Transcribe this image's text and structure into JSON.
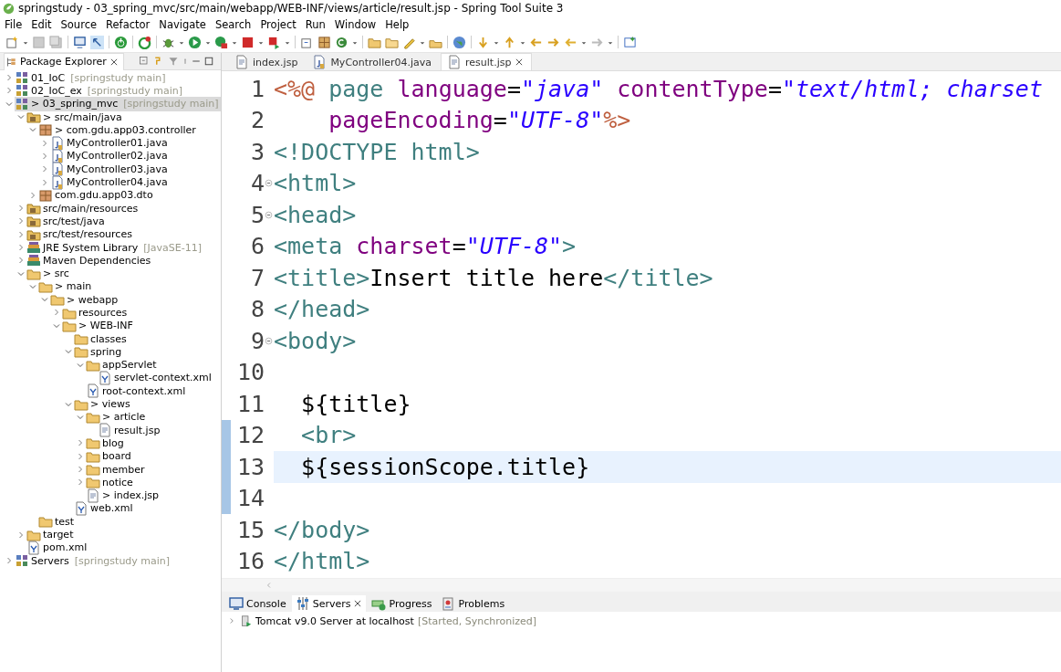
{
  "window": {
    "title": "springstudy - 03_spring_mvc/src/main/webapp/WEB-INF/views/article/result.jsp - Spring Tool Suite 3"
  },
  "menu": [
    "File",
    "Edit",
    "Source",
    "Refactor",
    "Navigate",
    "Search",
    "Project",
    "Run",
    "Window",
    "Help"
  ],
  "package_explorer": {
    "title": "Package Explorer",
    "items": [
      {
        "label": "01_IoC",
        "decoration": "[springstudy main]",
        "kind": "project",
        "expanded": false,
        "selected": false
      },
      {
        "label": "02_IoC_ex",
        "decoration": "[springstudy main]",
        "kind": "project",
        "expanded": false,
        "selected": false
      },
      {
        "label": "> 03_spring_mvc",
        "decoration": "[springstudy main]",
        "kind": "project",
        "expanded": true,
        "selected": true,
        "children": [
          {
            "label": "> src/main/java",
            "kind": "srcfolder",
            "expanded": true,
            "selected": false,
            "children": [
              {
                "label": "> com.gdu.app03.controller",
                "kind": "package",
                "expanded": true,
                "selected": false,
                "children": [
                  {
                    "label": "MyController01.java",
                    "kind": "java",
                    "expanded": false,
                    "selected": false
                  },
                  {
                    "label": "MyController02.java",
                    "kind": "java",
                    "expanded": false,
                    "selected": false
                  },
                  {
                    "label": "MyController03.java",
                    "kind": "java",
                    "expanded": false,
                    "selected": false
                  },
                  {
                    "label": "MyController04.java",
                    "kind": "java",
                    "expanded": false,
                    "selected": false
                  }
                ]
              },
              {
                "label": "com.gdu.app03.dto",
                "kind": "package",
                "expanded": false,
                "selected": false
              }
            ]
          },
          {
            "label": "src/main/resources",
            "kind": "srcfolder",
            "expanded": false,
            "selected": false
          },
          {
            "label": "src/test/java",
            "kind": "srcfolder",
            "expanded": false,
            "selected": false
          },
          {
            "label": "src/test/resources",
            "kind": "srcfolder",
            "expanded": false,
            "selected": false
          },
          {
            "label": "JRE System Library",
            "decoration": "[JavaSE-11]",
            "kind": "library",
            "expanded": false,
            "selected": false
          },
          {
            "label": "Maven Dependencies",
            "kind": "library",
            "expanded": false,
            "selected": false
          },
          {
            "label": "> src",
            "kind": "folder",
            "expanded": true,
            "selected": false,
            "children": [
              {
                "label": "> main",
                "kind": "folder",
                "expanded": true,
                "selected": false,
                "children": [
                  {
                    "label": "> webapp",
                    "kind": "folder",
                    "expanded": true,
                    "selected": false,
                    "children": [
                      {
                        "label": "resources",
                        "kind": "folder",
                        "expanded": false,
                        "selected": false
                      },
                      {
                        "label": "> WEB-INF",
                        "kind": "folder",
                        "expanded": true,
                        "selected": false,
                        "children": [
                          {
                            "label": "classes",
                            "kind": "folder",
                            "selected": false
                          },
                          {
                            "label": "spring",
                            "kind": "folder",
                            "expanded": true,
                            "selected": false,
                            "children": [
                              {
                                "label": "appServlet",
                                "kind": "folder",
                                "expanded": true,
                                "selected": false,
                                "children": [
                                  {
                                    "label": "servlet-context.xml",
                                    "kind": "xml",
                                    "selected": false
                                  }
                                ]
                              },
                              {
                                "label": "root-context.xml",
                                "kind": "xml",
                                "selected": false
                              }
                            ]
                          },
                          {
                            "label": "> views",
                            "kind": "folder",
                            "expanded": true,
                            "selected": false,
                            "children": [
                              {
                                "label": "> article",
                                "kind": "folder",
                                "expanded": true,
                                "selected": false,
                                "children": [
                                  {
                                    "label": "result.jsp",
                                    "kind": "jsp",
                                    "selected": false
                                  }
                                ]
                              },
                              {
                                "label": "blog",
                                "kind": "folder",
                                "expanded": false,
                                "selected": false
                              },
                              {
                                "label": "board",
                                "kind": "folder",
                                "expanded": false,
                                "selected": false
                              },
                              {
                                "label": "member",
                                "kind": "folder",
                                "expanded": false,
                                "selected": false
                              },
                              {
                                "label": "notice",
                                "kind": "folder",
                                "expanded": false,
                                "selected": false
                              },
                              {
                                "label": "> index.jsp",
                                "kind": "jsp",
                                "selected": false
                              }
                            ]
                          },
                          {
                            "label": "web.xml",
                            "kind": "xml",
                            "selected": false
                          }
                        ]
                      }
                    ]
                  }
                ]
              },
              {
                "label": "test",
                "kind": "folder",
                "selected": false
              }
            ]
          },
          {
            "label": "target",
            "kind": "folder",
            "expanded": false,
            "selected": false
          },
          {
            "label": "pom.xml",
            "kind": "xml",
            "selected": false
          }
        ]
      },
      {
        "label": "Servers",
        "decoration": "[springstudy main]",
        "kind": "project",
        "expanded": false,
        "selected": false
      }
    ]
  },
  "editor": {
    "tabs": [
      {
        "label": "index.jsp",
        "kind": "jsp",
        "selected": false
      },
      {
        "label": "MyController04.java",
        "kind": "java",
        "selected": false
      },
      {
        "label": "result.jsp",
        "kind": "jsp",
        "selected": true
      }
    ],
    "lines": [
      {
        "number": "1",
        "tokens": [
          {
            "kind": "jsp",
            "text": "<%@"
          },
          {
            "kind": "tag",
            "text": " page"
          },
          {
            "kind": "attr",
            "text": " language"
          },
          {
            "kind": "plain",
            "text": "="
          },
          {
            "kind": "string",
            "text": "\"java\""
          },
          {
            "kind": "attr",
            "text": " contentType"
          },
          {
            "kind": "plain",
            "text": "="
          },
          {
            "kind": "string",
            "text": "\"text/html; charset"
          }
        ]
      },
      {
        "number": "2",
        "tokens": [
          {
            "kind": "attr",
            "text": "    pageEncoding"
          },
          {
            "kind": "plain",
            "text": "="
          },
          {
            "kind": "string",
            "text": "\"UTF-8\""
          },
          {
            "kind": "jsp",
            "text": "%>"
          }
        ]
      },
      {
        "number": "3",
        "tokens": [
          {
            "kind": "tag",
            "text": "<!DOCTYPE html>"
          }
        ]
      },
      {
        "number": "4",
        "fold": true,
        "tokens": [
          {
            "kind": "tag",
            "text": "<html>"
          }
        ]
      },
      {
        "number": "5",
        "fold": true,
        "tokens": [
          {
            "kind": "tag",
            "text": "<head>"
          }
        ]
      },
      {
        "number": "6",
        "tokens": [
          {
            "kind": "tag",
            "text": "<meta"
          },
          {
            "kind": "attr",
            "text": " charset"
          },
          {
            "kind": "plain",
            "text": "="
          },
          {
            "kind": "string",
            "text": "\"UTF-8\""
          },
          {
            "kind": "tag",
            "text": ">"
          }
        ]
      },
      {
        "number": "7",
        "tokens": [
          {
            "kind": "tag",
            "text": "<title>"
          },
          {
            "kind": "plain",
            "text": "Insert title here"
          },
          {
            "kind": "tag",
            "text": "</title>"
          }
        ]
      },
      {
        "number": "8",
        "tokens": [
          {
            "kind": "tag",
            "text": "</head>"
          }
        ]
      },
      {
        "number": "9",
        "fold": true,
        "tokens": [
          {
            "kind": "tag",
            "text": "<body>"
          }
        ]
      },
      {
        "number": "10"
      },
      {
        "number": "11",
        "tokens": [
          {
            "kind": "plain",
            "text": "  ${title}"
          }
        ]
      },
      {
        "number": "12",
        "changed": true,
        "tokens": [
          {
            "kind": "tag",
            "text": "  <br>"
          }
        ]
      },
      {
        "number": "13",
        "changed": true,
        "current": true,
        "tokens": [
          {
            "kind": "plain",
            "text": "  ${sessionScope.title}"
          }
        ]
      },
      {
        "number": "14",
        "changed": true
      },
      {
        "number": "15",
        "tokens": [
          {
            "kind": "tag",
            "text": "</body>"
          }
        ]
      },
      {
        "number": "16",
        "tokens": [
          {
            "kind": "tag",
            "text": "</html>"
          }
        ]
      }
    ]
  },
  "bottom_panel": {
    "tabs": [
      {
        "label": "Console",
        "kind": "console",
        "selected": false
      },
      {
        "label": "Servers",
        "kind": "servers",
        "selected": true
      },
      {
        "label": "Progress",
        "kind": "progress",
        "selected": false
      },
      {
        "label": "Problems",
        "kind": "problems",
        "selected": false
      }
    ],
    "servers": [
      {
        "name": "Tomcat v9.0 Server at localhost",
        "status": "[Started, Synchronized]",
        "expanded": false
      }
    ]
  }
}
